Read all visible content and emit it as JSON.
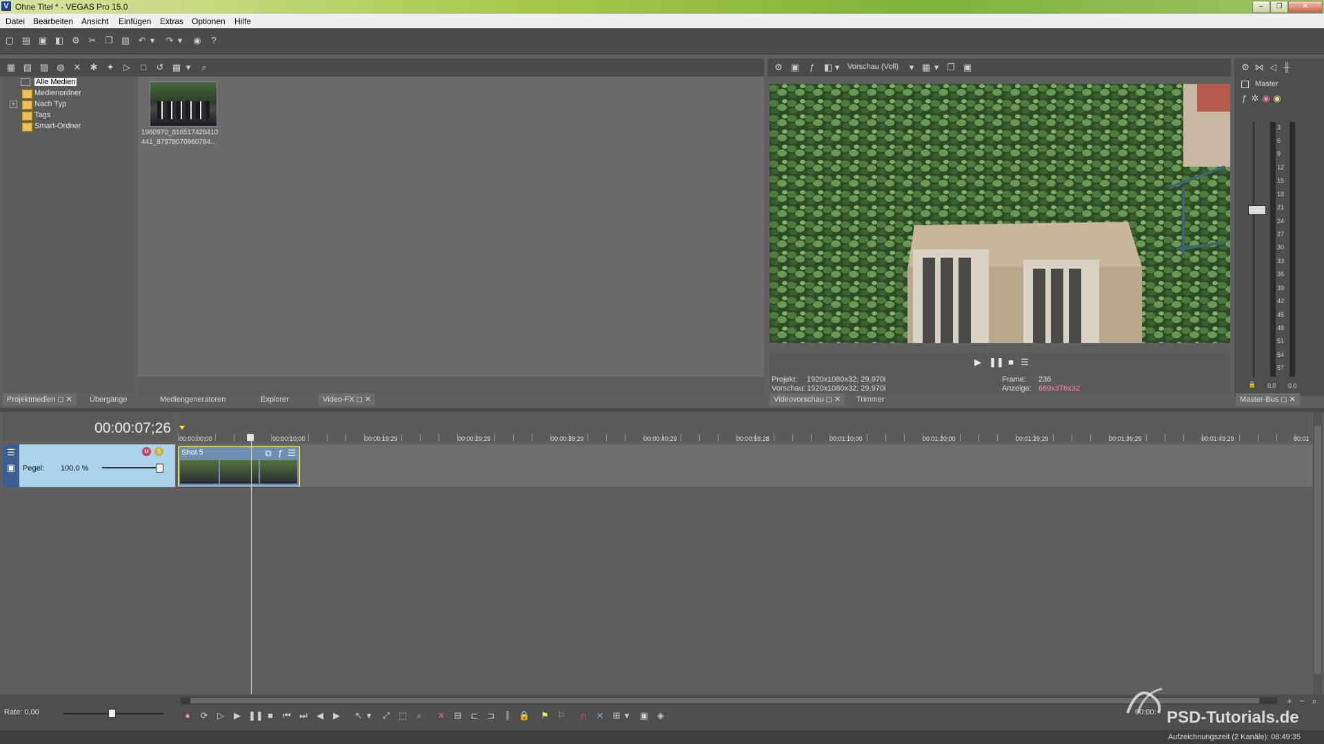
{
  "window": {
    "title": "Ohne Titel * - VEGAS Pro 15.0",
    "app_icon": "V",
    "controls": [
      "–",
      "❐",
      "✕"
    ]
  },
  "menu": [
    "Datei",
    "Bearbeiten",
    "Ansicht",
    "Einfügen",
    "Extras",
    "Optionen",
    "Hilfe"
  ],
  "media": {
    "tree": [
      "Alle Medien",
      "Medienordner",
      "Nach Typ",
      "Tags",
      "Smart-Ordner"
    ],
    "thumb_caption_1": "1960970_816517428410",
    "thumb_caption_2": "441_87978070960784..."
  },
  "tabs_left": [
    "Projektmedien",
    "Übergänge",
    "Mediengeneratoren",
    "Explorer",
    "Video-FX"
  ],
  "preview": {
    "quality": "Vorschau (Voll)",
    "projekt_label": "Projekt:",
    "projekt_value": "1920x1080x32; 29,970i",
    "vorschau_label": "Vorschau:",
    "vorschau_value": "1920x1080x32; 29,970i",
    "frame_label": "Frame:",
    "frame_value": "236",
    "anzeige_label": "Anzeige:",
    "anzeige_value": "669x376x32",
    "tabs": [
      "Videovorschau",
      "Trimmer"
    ]
  },
  "master": {
    "label": "Master",
    "tab": "Master-Bus",
    "scale": [
      "3",
      "6",
      "9",
      "12",
      "15",
      "18",
      "21",
      "24",
      "27",
      "30",
      "33",
      "36",
      "39",
      "42",
      "45",
      "48",
      "51",
      "54",
      "57"
    ],
    "bottom_left": "0.0",
    "bottom_right": "0.0"
  },
  "timeline": {
    "timecode": "00:00:07;26",
    "track_level_label": "Pegel:",
    "track_level_value": "100,0 %",
    "clip_name": "Shot 5",
    "ruler": [
      "00:00:00;00",
      "00:00:10;00",
      "00:00:19;29",
      "00:00:29;29",
      "00:00:39;29",
      "00:00:49;29",
      "00:00:59;28",
      "00:01:10;00",
      "00:01:20;00",
      "00:01:29;29",
      "00:01:39;29",
      "00:01:49;29",
      "00:01"
    ],
    "rate": "Rate: 0,00",
    "time_right": "00:00:"
  },
  "status": {
    "recording": "Aufzeichnungszeit (2 Kanäle): 08:49:35"
  },
  "watermark": "PSD-Tutorials.de",
  "colors": {
    "track_header": "#a8d3ea",
    "clip_border": "#ffff66",
    "anzeige": "#ff8aa0"
  }
}
